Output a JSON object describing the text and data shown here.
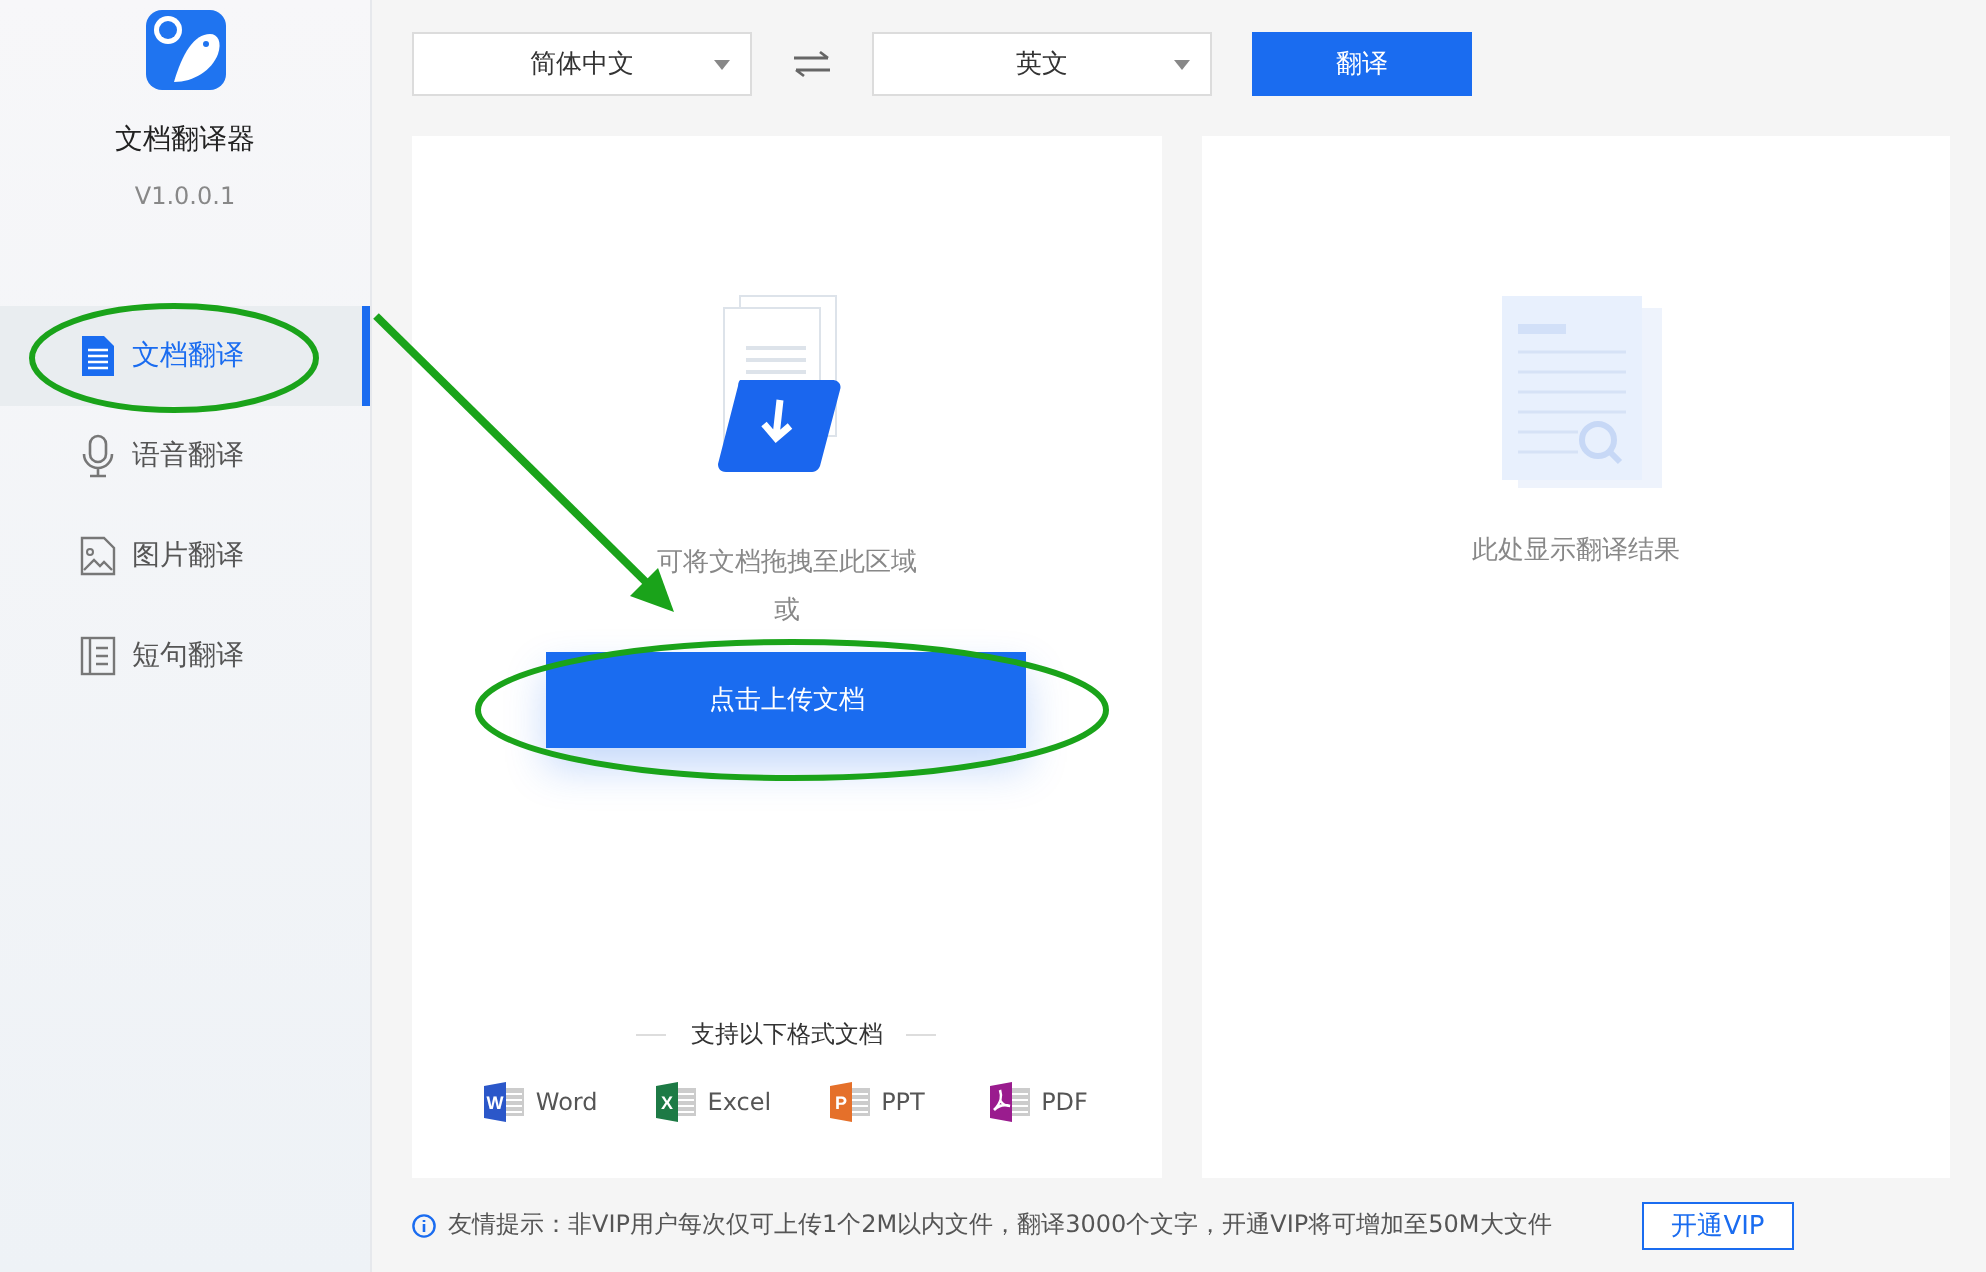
{
  "sidebar": {
    "app_name": "文档翻译器",
    "version": "V1.0.0.1",
    "items": [
      {
        "label": "文档翻译",
        "kind": "document",
        "selected": true
      },
      {
        "label": "语音翻译",
        "kind": "voice",
        "selected": false
      },
      {
        "label": "图片翻译",
        "kind": "image",
        "selected": false
      },
      {
        "label": "短句翻译",
        "kind": "sentence",
        "selected": false
      }
    ]
  },
  "toolbar": {
    "source_language": "简体中文",
    "target_language": "英文",
    "translate_button": "翻译"
  },
  "upload_panel": {
    "hint": "可将文档拖拽至此区域",
    "or": "或",
    "upload_button": "点击上传文档",
    "formats_title": "支持以下格式文档",
    "formats": [
      {
        "label": "Word",
        "kind": "word",
        "icon_letter": "W"
      },
      {
        "label": "Excel",
        "kind": "excel",
        "icon_letter": "X"
      },
      {
        "label": "PPT",
        "kind": "ppt",
        "icon_letter": "P"
      },
      {
        "label": "PDF",
        "kind": "pdf"
      }
    ]
  },
  "result_panel": {
    "message": "此处显示翻译结果"
  },
  "footer": {
    "tip": "友情提示：非VIP用户每次仅可上传1个2M以内文件，翻译3000个文字，开通VIP将可增加至50M大文件",
    "vip_button": "开通VIP"
  }
}
